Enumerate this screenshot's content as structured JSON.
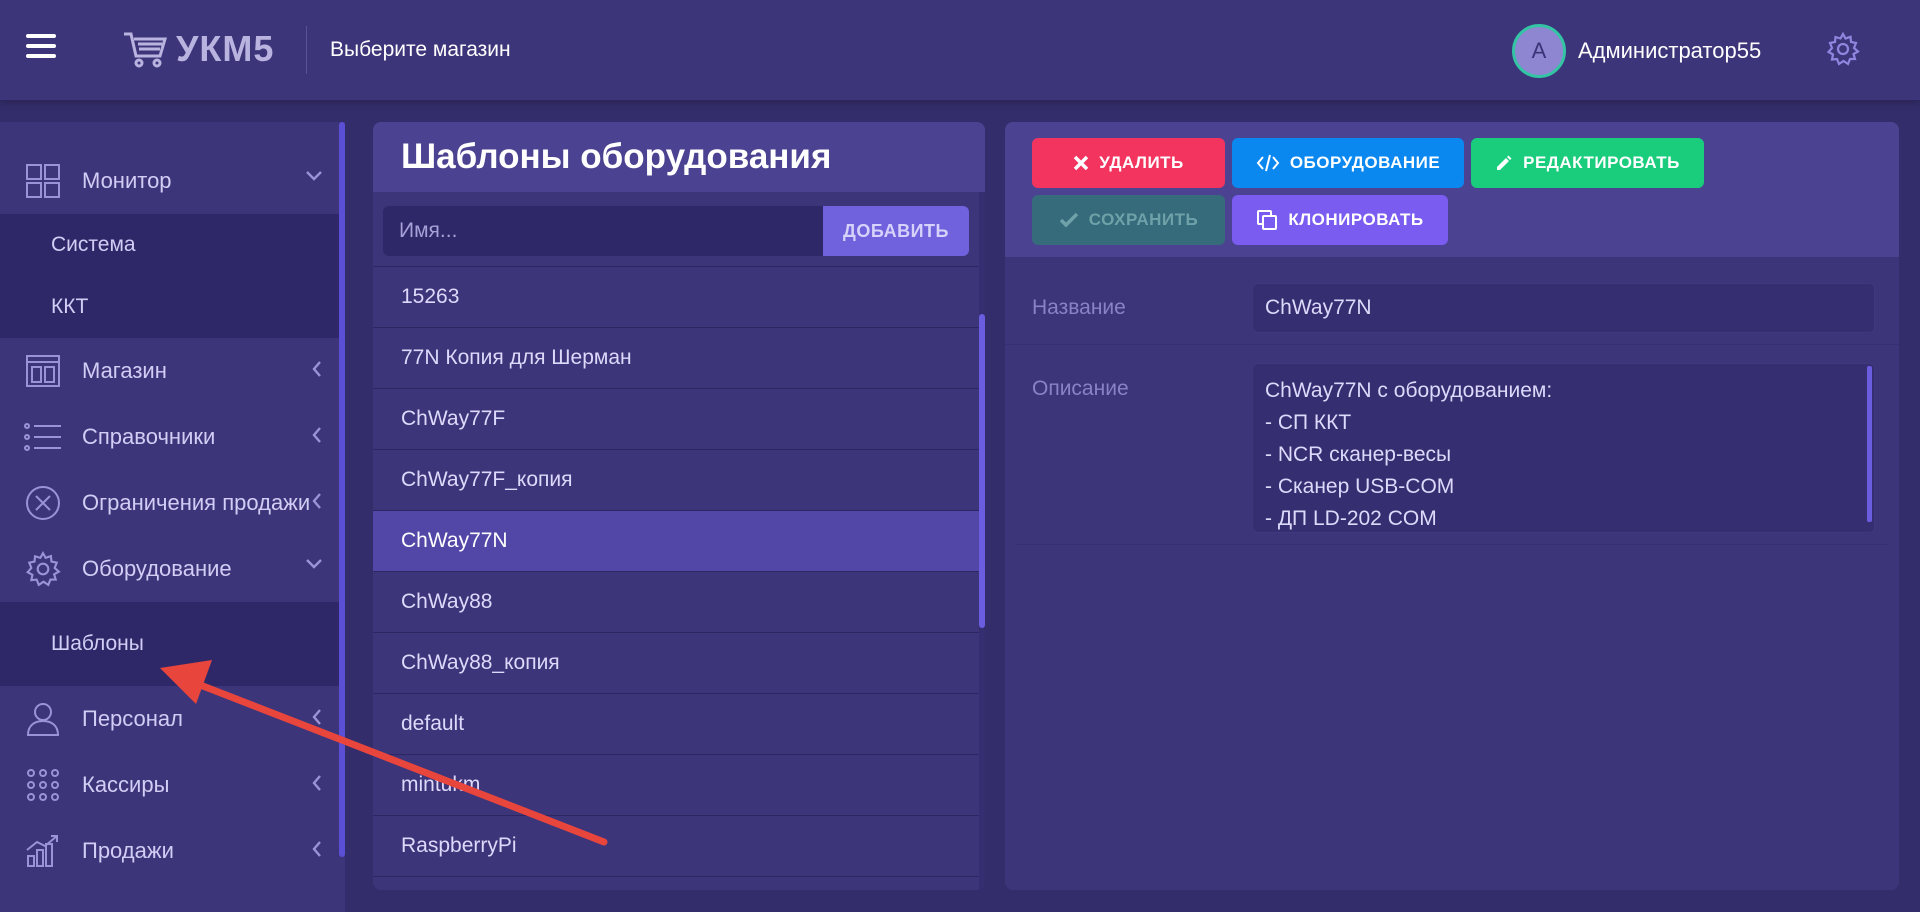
{
  "header": {
    "logo_text": "УКМ5",
    "store_selector": "Выберите магазин",
    "avatar_initial": "A",
    "user_name": "Администратор55"
  },
  "sidebar": {
    "items": [
      {
        "label": "Монитор",
        "expanded": true,
        "children": [
          "Система",
          "ККТ"
        ]
      },
      {
        "label": "Магазин"
      },
      {
        "label": "Справочники"
      },
      {
        "label": "Ограничения продажи"
      },
      {
        "label": "Оборудование",
        "expanded": true,
        "children": [
          "Шаблоны"
        ]
      },
      {
        "label": "Персонал"
      },
      {
        "label": "Кассиры"
      },
      {
        "label": "Продажи"
      }
    ]
  },
  "templates_panel": {
    "title": "Шаблоны оборудования",
    "search_placeholder": "Имя...",
    "add_label": "ДОБАВИТЬ",
    "items": [
      "15263",
      "77N Копия для Шерман",
      "ChWay77F",
      "ChWay77F_копия",
      "ChWay77N",
      "ChWay88",
      "ChWay88_копия",
      "default",
      "mintukm",
      "RaspberryPi"
    ],
    "selected_index": 4
  },
  "detail_panel": {
    "buttons": {
      "delete": "УДАЛИТЬ",
      "equipment": "ОБОРУДОВАНИЕ",
      "edit": "РЕДАКТИРОВАТЬ",
      "save": "СОХРАНИТЬ",
      "clone": "КЛОНИРОВАТЬ"
    },
    "name_label": "Название",
    "name_value": "ChWay77N",
    "description_label": "Описание",
    "description_lines": [
      "ChWay77N с оборудованием:",
      "- СП ККТ",
      "- NCR сканер-весы",
      "- Сканер USB-COM",
      "- ДП LD-202 COM"
    ]
  },
  "colors": {
    "background": "#342d6b",
    "panel": "#3d3579",
    "panel_header": "#4b4392",
    "selected_row": "#5247a6",
    "delete": "#f2345f",
    "equipment": "#0b88f0",
    "edit": "#19cd7c",
    "save_disabled": "#356b7a",
    "clone": "#7a5df0",
    "annotation_arrow": "#e8453c"
  }
}
